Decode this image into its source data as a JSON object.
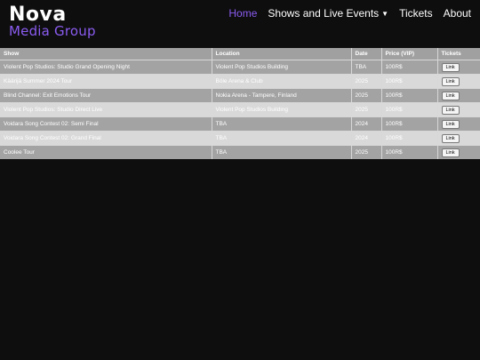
{
  "logo": {
    "top": "Nova",
    "bottom": "Media Group"
  },
  "nav": {
    "home": "Home",
    "shows": "Shows and Live Events",
    "tickets": "Tickets",
    "about": "About"
  },
  "table": {
    "headers": [
      "Show",
      "Location",
      "Date",
      "Price (VIP)",
      "Tickets"
    ],
    "rows": [
      {
        "show": "Violent Pop Studios: Studio Grand Opening Night",
        "location": "Violent Pop Studios Building",
        "date": "TBA",
        "price": "100R$",
        "link": "Link"
      },
      {
        "show": "Käärijä Summer 2024 Tour",
        "location": "Böle Arena & Club",
        "date": "2025",
        "price": "100R$",
        "link": "Link"
      },
      {
        "show": "Blind Channel: Exit Emotions Tour",
        "location": "Nokia Arena - Tampere, Finland",
        "date": "2025",
        "price": "100R$",
        "link": "Link"
      },
      {
        "show": "Violent Pop Studios: Studio Direct Live",
        "location": "Violent Pop Studios Building",
        "date": "2025",
        "price": "100R$",
        "link": "Link"
      },
      {
        "show": "Voidara Song Contest 02: Semi Final",
        "location": "TBA",
        "date": "2024",
        "price": "100R$",
        "link": "Link"
      },
      {
        "show": "Voidara Song Contest 02: Grand Final",
        "location": "TBA",
        "date": "2024",
        "price": "100R$",
        "link": "Link"
      },
      {
        "show": "Coolee Tour",
        "location": "TBA",
        "date": "2025",
        "price": "100R$",
        "link": "Link"
      }
    ]
  },
  "colors": {
    "accent": "#8a5cf0",
    "background": "#0e0e0e",
    "row_dark": "#a3a3a3",
    "row_light": "#d9d9d9"
  }
}
